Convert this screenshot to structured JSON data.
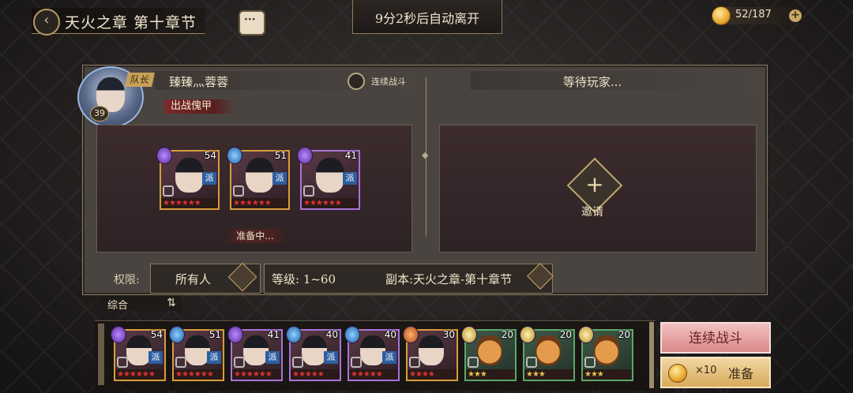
{
  "header": {
    "chapter_title": "天火之章 第十章节",
    "auto_leave_timer": "9分2秒后自动离开",
    "stamina": "52/187"
  },
  "leader": {
    "badge": "队长",
    "level": "39",
    "name": "臻臻灬蓉蓉",
    "continuous_battle_label": "连续战斗",
    "deploy_tag": "出战傀甲",
    "status": "准备中...",
    "heroes": [
      {
        "level": "54",
        "sect": "purple",
        "pai": "派",
        "stars": "★★★★★★"
      },
      {
        "level": "51",
        "sect": "blue",
        "pai": "派",
        "stars": "★★★★★★"
      },
      {
        "level": "41",
        "sect": "purple",
        "pai": "派",
        "stars": "★★★★★★"
      }
    ]
  },
  "second_slot": {
    "waiting": "等待玩家...",
    "invite": "邀请"
  },
  "settings": {
    "permission_label": "权限:",
    "permission_value": "所有人",
    "level_range": "等级:  1~60",
    "dungeon": "副本:天火之章-第十章节"
  },
  "roster": {
    "filter": "综合",
    "sort_icon": "swap-icon",
    "heroes": [
      {
        "level": "54",
        "style": "gold",
        "sect": "purple",
        "pai": "派",
        "stars": "★★★★★★"
      },
      {
        "level": "51",
        "style": "gold",
        "sect": "blue",
        "pai": "派",
        "stars": "★★★★★★"
      },
      {
        "level": "41",
        "style": "purple",
        "sect": "purple",
        "pai": "派",
        "stars": "★★★★★★"
      },
      {
        "level": "40",
        "style": "purple",
        "sect": "blue",
        "pai": "派",
        "stars": "★★★★★"
      },
      {
        "level": "40",
        "style": "purple",
        "sect": "blue",
        "pai": "派",
        "stars": "★★★★★"
      },
      {
        "level": "30",
        "style": "gold",
        "sect": "orange",
        "pai": "",
        "stars": "★★★★"
      },
      {
        "level": "20",
        "style": "green",
        "sect": "gold",
        "pai": "",
        "stars": "★★★"
      },
      {
        "level": "20",
        "style": "green",
        "sect": "gold",
        "pai": "",
        "stars": "★★★"
      },
      {
        "level": "20",
        "style": "green",
        "sect": "gold",
        "pai": "",
        "stars": "★★★"
      }
    ]
  },
  "actions": {
    "continuous_battle": "连续战斗",
    "ready_cost": "×10",
    "ready": "准备"
  },
  "colors": {
    "accent_gold": "#c9a767",
    "cont_button": "#d9898a",
    "ready_button": "#d7ab5a"
  }
}
